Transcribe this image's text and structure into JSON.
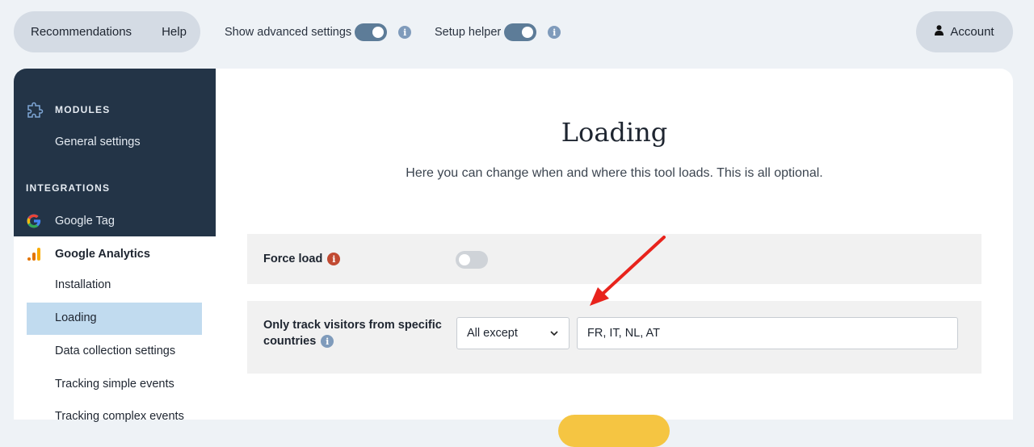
{
  "topbar": {
    "nav_items": [
      "Recommendations",
      "Help"
    ],
    "advanced_label": "Show advanced settings",
    "helper_label": "Setup helper",
    "account_label": "Account"
  },
  "sidebar": {
    "modules_heading": "MODULES",
    "general_settings": "General settings",
    "integrations_heading": "INTEGRATIONS",
    "google_tag": "Google Tag",
    "google_analytics": "Google Analytics",
    "sub_items": [
      "Installation",
      "Loading",
      "Data collection settings",
      "Tracking simple events",
      "Tracking complex events"
    ],
    "selected": "Loading"
  },
  "main": {
    "title": "Loading",
    "subtitle": "Here you can change when and where this tool loads. This is all optional.",
    "force_load_label": "Force load",
    "countries_label_line1": "Only track visitors from specific",
    "countries_label_line2": "countries",
    "country_mode": "All except",
    "countries_value": "FR, IT, NL, AT"
  },
  "colors": {
    "sidebar_dark": "#233447",
    "accent_toggle": "#5d7c98",
    "selected_item": "#c1dbef",
    "annotation_arrow": "#e8231c",
    "save_button": "#f5c542"
  }
}
